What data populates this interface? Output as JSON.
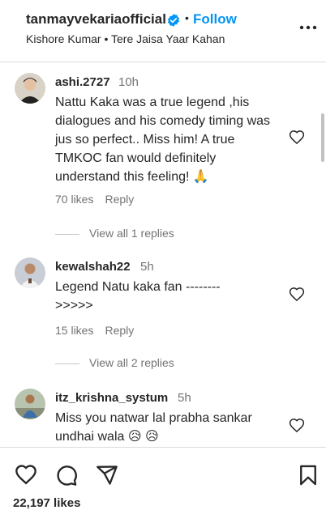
{
  "header": {
    "username": "tanmayvekariaofficial",
    "separator": "•",
    "follow_label": "Follow",
    "music": "Kishore Kumar • Tere Jaisa Yaar Kahan"
  },
  "comments": [
    {
      "username": "ashi.2727",
      "time": "10h",
      "text": "Nattu Kaka was a true legend ,his dialogues and his comedy timing was jus so perfect.. Miss him! A true TMKOC fan would definitely understand this feeling! 🙏",
      "likes": "70 likes",
      "reply_label": "Reply",
      "view_replies": "View all 1 replies"
    },
    {
      "username": "kewalshah22",
      "time": "5h",
      "text": "Legend Natu kaka fan -------- >>>>>",
      "likes": "15 likes",
      "reply_label": "Reply",
      "view_replies": "View all 2 replies"
    },
    {
      "username": "itz_krishna_systum",
      "time": "5h",
      "text": "Miss you natwar lal prabha sankar undhai wala 😥 😥"
    }
  ],
  "footer": {
    "likes": "22,197 likes"
  },
  "colors": {
    "link": "#0095f6",
    "verified": "#0095f6",
    "muted": "#737373",
    "text": "#262626"
  },
  "icons": [
    "verified-badge-icon",
    "more-options-icon",
    "heart-icon",
    "comment-icon",
    "share-icon",
    "bookmark-icon"
  ]
}
